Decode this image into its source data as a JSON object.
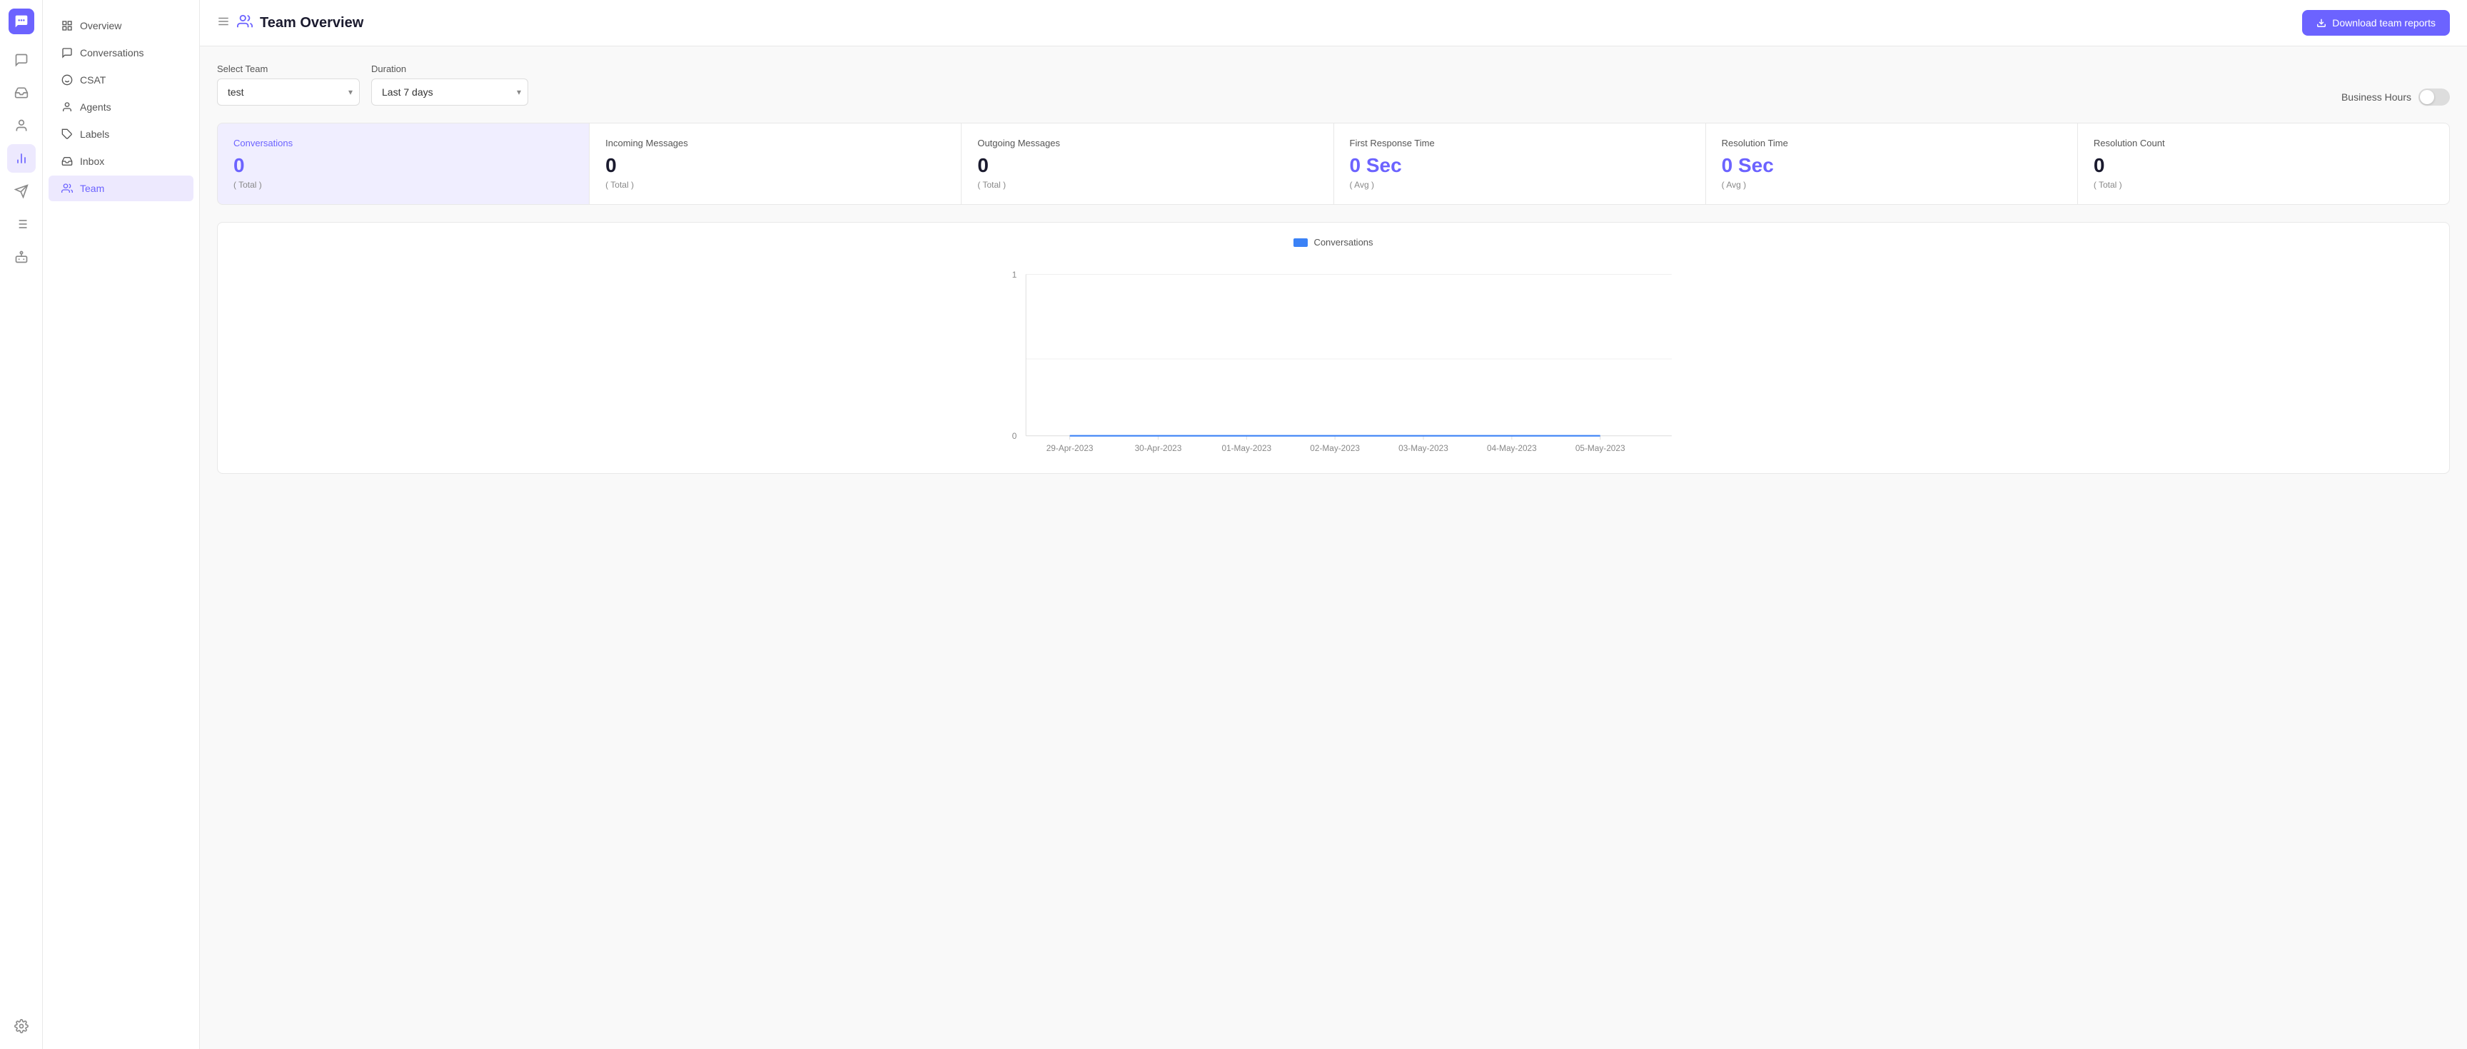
{
  "app": {
    "logo": "💬"
  },
  "header": {
    "menu_icon": "☰",
    "page_icon": "👥",
    "title": "Team Overview",
    "download_btn": "Download team reports",
    "download_icon": "⬇"
  },
  "sidebar": {
    "items": [
      {
        "id": "overview",
        "label": "Overview",
        "icon": "overview"
      },
      {
        "id": "conversations",
        "label": "Conversations",
        "icon": "conversations"
      },
      {
        "id": "csat",
        "label": "CSAT",
        "icon": "csat"
      },
      {
        "id": "agents",
        "label": "Agents",
        "icon": "agents"
      },
      {
        "id": "labels",
        "label": "Labels",
        "icon": "labels"
      },
      {
        "id": "inbox",
        "label": "Inbox",
        "icon": "inbox"
      },
      {
        "id": "team",
        "label": "Team",
        "icon": "team",
        "active": true
      }
    ]
  },
  "filters": {
    "team_label": "Select Team",
    "team_value": "test",
    "team_placeholder": "test",
    "duration_label": "Duration",
    "duration_value": "Last 7 days",
    "business_hours_label": "Business Hours"
  },
  "stats": [
    {
      "id": "conversations",
      "title": "Conversations",
      "value": "0",
      "sub": "( Total )",
      "active": true
    },
    {
      "id": "incoming",
      "title": "Incoming Messages",
      "value": "0",
      "sub": "( Total )",
      "active": false
    },
    {
      "id": "outgoing",
      "title": "Outgoing Messages",
      "value": "0",
      "sub": "( Total )",
      "active": false
    },
    {
      "id": "first_response",
      "title": "First Response Time",
      "value": "0 Sec",
      "sub": "( Avg )",
      "active": false
    },
    {
      "id": "resolution_time",
      "title": "Resolution Time",
      "value": "0 Sec",
      "sub": "( Avg )",
      "active": false
    },
    {
      "id": "resolution_count",
      "title": "Resolution Count",
      "value": "0",
      "sub": "( Total )",
      "active": false
    }
  ],
  "chart": {
    "legend_label": "Conversations",
    "y_axis": {
      "max": "1",
      "min": "0"
    },
    "x_axis_labels": [
      "29-Apr-2023",
      "30-Apr-2023",
      "01-May-2023",
      "02-May-2023",
      "03-May-2023",
      "04-May-2023",
      "05-May-2023"
    ]
  },
  "icon_nav": {
    "items": [
      {
        "id": "chat",
        "icon": "💬",
        "active": false
      },
      {
        "id": "inbox2",
        "icon": "📥",
        "active": false
      },
      {
        "id": "contacts",
        "icon": "👤",
        "active": false
      },
      {
        "id": "reports",
        "icon": "📊",
        "active": true
      },
      {
        "id": "campaigns",
        "icon": "📣",
        "active": false
      },
      {
        "id": "reports2",
        "icon": "📋",
        "active": false
      },
      {
        "id": "bot",
        "icon": "🤖",
        "active": false
      },
      {
        "id": "settings",
        "icon": "⚙",
        "active": false
      }
    ]
  }
}
